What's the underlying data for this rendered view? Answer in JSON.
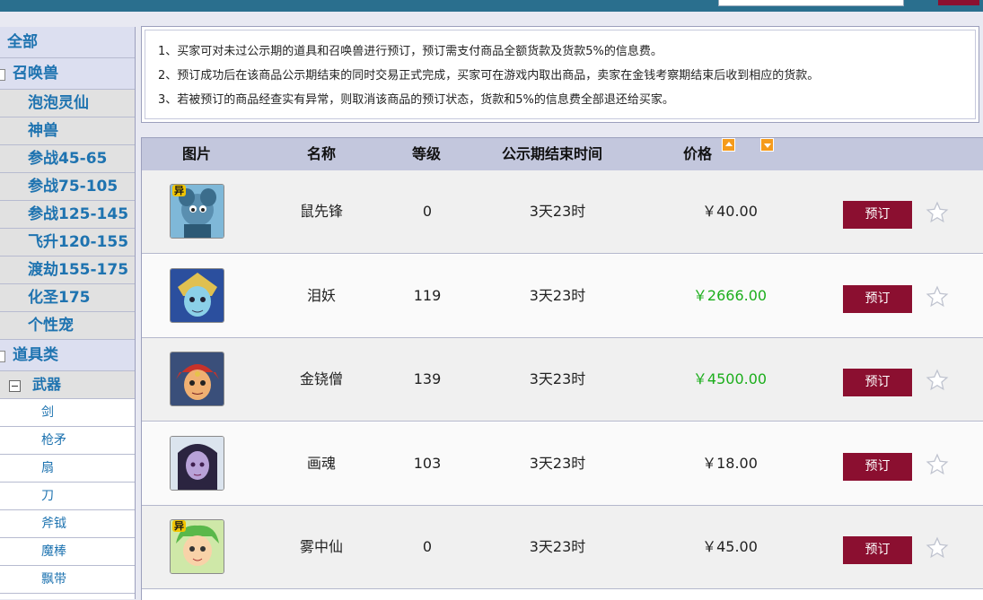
{
  "sidebar": {
    "top": "全部",
    "summon_category": "召唤兽",
    "summon_items": [
      "泡泡灵仙",
      "神兽",
      "参战45-65",
      "参战75-105",
      "参战125-145",
      "飞升120-155",
      "渡劫155-175",
      "化圣175",
      "个性宠"
    ],
    "item_category": "道具类",
    "weapon_group": "武器",
    "weapon_items": [
      "剑",
      "枪矛",
      "扇",
      "刀",
      "斧钺",
      "魔棒",
      "飘带"
    ]
  },
  "notice": [
    "1、买家可对未过公示期的道具和召唤兽进行预订，预订需支付商品全额货款及货款5%的信息费。",
    "2、预订成功后在该商品公示期结束的同时交易正式完成，买家可在游戏内取出商品，卖家在金钱考察期结束后收到相应的货款。",
    "3、若被预订的商品经查实有异常，则取消该商品的预订状态，货款和5%的信息费全部退还给买家。"
  ],
  "table": {
    "headers": {
      "image": "图片",
      "name": "名称",
      "level": "等级",
      "end_time": "公示期结束时间",
      "price": "价格"
    },
    "rows": [
      {
        "name": "鼠先锋",
        "level": "0",
        "end_time": "3天23时",
        "price": "￥40.00",
        "price_color": "#222222",
        "button": "预订",
        "avatar_icon": "mouse-pet-avatar-icon",
        "badge": "异"
      },
      {
        "name": "泪妖",
        "level": "119",
        "end_time": "3天23时",
        "price": "￥2666.00",
        "price_color": "#1cae1c",
        "button": "预订",
        "avatar_icon": "tear-demon-avatar-icon",
        "badge": ""
      },
      {
        "name": "金铙僧",
        "level": "139",
        "end_time": "3天23时",
        "price": "￥4500.00",
        "price_color": "#1cae1c",
        "button": "预订",
        "avatar_icon": "monk-avatar-icon",
        "badge": ""
      },
      {
        "name": "画魂",
        "level": "103",
        "end_time": "3天23时",
        "price": "￥18.00",
        "price_color": "#222222",
        "button": "预订",
        "avatar_icon": "painted-soul-avatar-icon",
        "badge": ""
      },
      {
        "name": "雾中仙",
        "level": "0",
        "end_time": "3天23时",
        "price": "￥45.00",
        "price_color": "#222222",
        "button": "预订",
        "avatar_icon": "mist-fairy-avatar-icon",
        "badge": "异"
      }
    ]
  },
  "colors": {
    "accent": "#8b0f30",
    "link": "#1e73b0",
    "price_highlight": "#1cae1c",
    "header_bg": "#c3c7dd"
  }
}
